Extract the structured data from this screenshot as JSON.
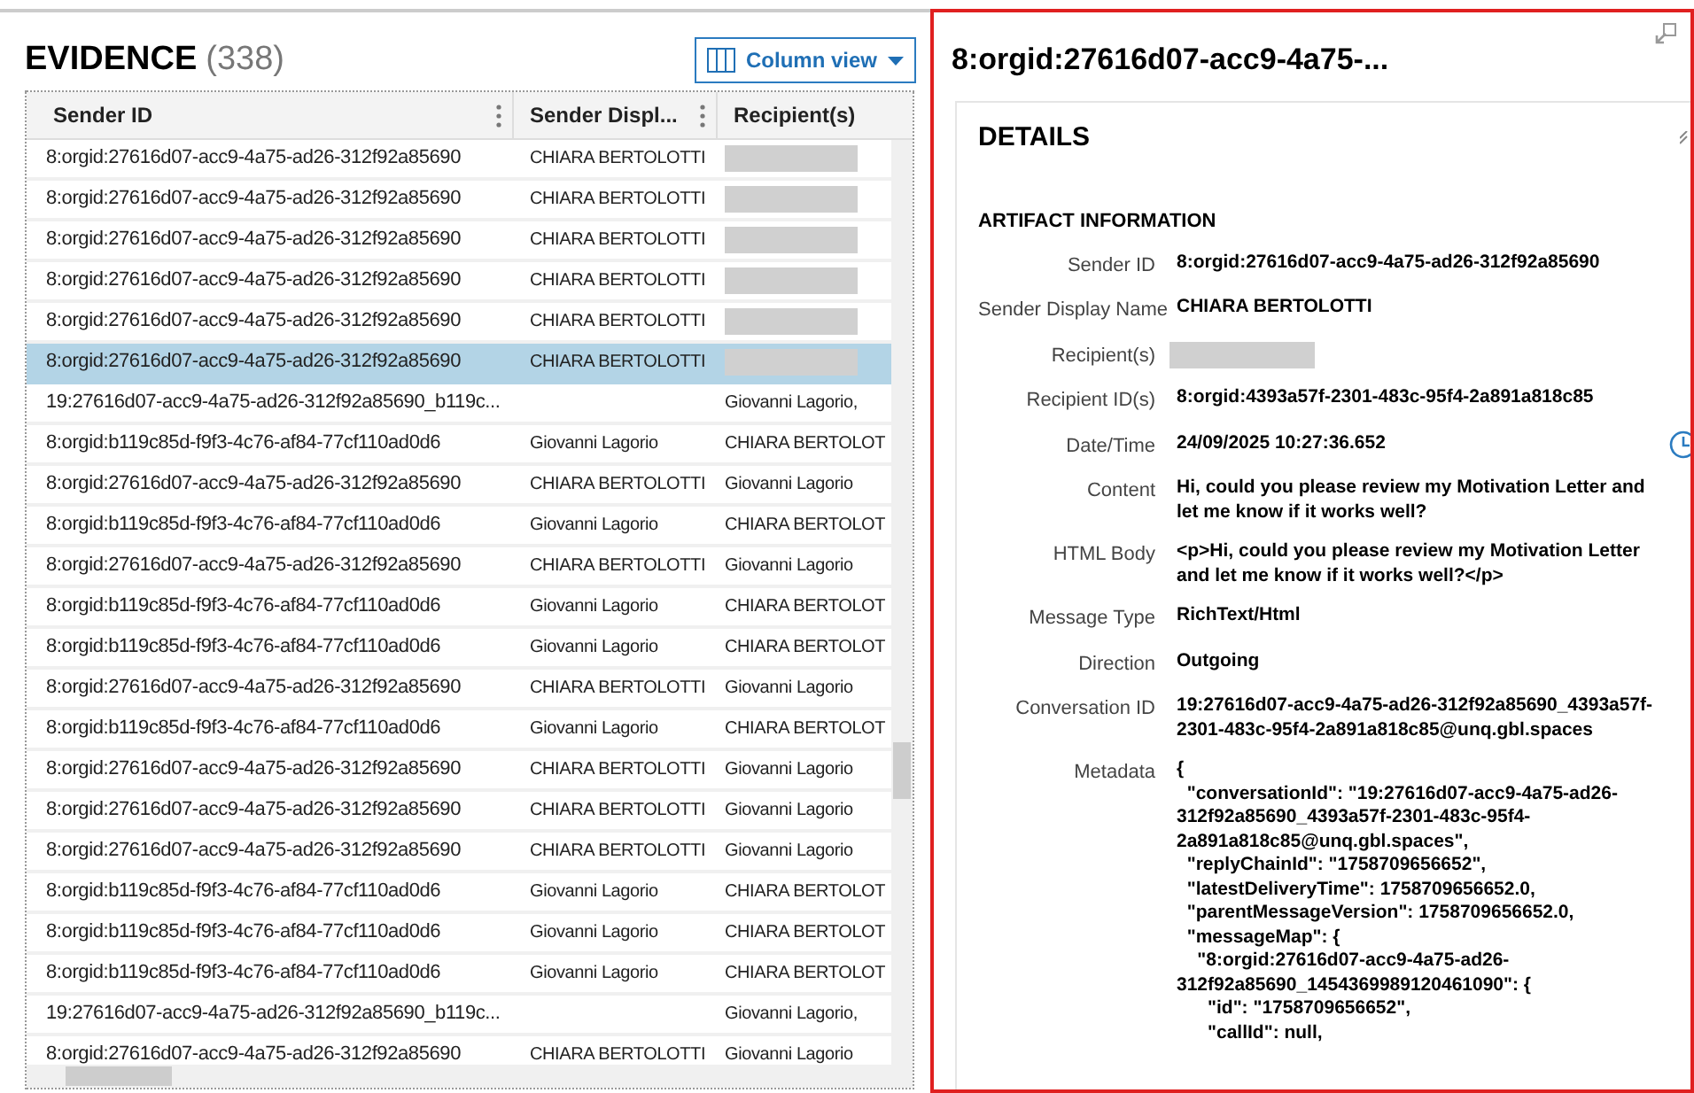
{
  "evidence": {
    "title": "EVIDENCE",
    "count": "(338)",
    "column_view_button": "Column view"
  },
  "table": {
    "columns": [
      "Sender ID",
      "Sender Displ...",
      "Recipient(s)"
    ],
    "rows": [
      {
        "sender_id": "8:orgid:27616d07-acc9-4a75-ad26-312f92a85690",
        "sender_display": "CHIARA BERTOLOTTI",
        "recipient_redacted": true,
        "selected": false
      },
      {
        "sender_id": "8:orgid:27616d07-acc9-4a75-ad26-312f92a85690",
        "sender_display": "CHIARA BERTOLOTTI",
        "recipient_redacted": true,
        "selected": false
      },
      {
        "sender_id": "8:orgid:27616d07-acc9-4a75-ad26-312f92a85690",
        "sender_display": "CHIARA BERTOLOTTI",
        "recipient_redacted": true,
        "selected": false
      },
      {
        "sender_id": "8:orgid:27616d07-acc9-4a75-ad26-312f92a85690",
        "sender_display": "CHIARA BERTOLOTTI",
        "recipient_redacted": true,
        "selected": false
      },
      {
        "sender_id": "8:orgid:27616d07-acc9-4a75-ad26-312f92a85690",
        "sender_display": "CHIARA BERTOLOTTI",
        "recipient_redacted": true,
        "selected": false
      },
      {
        "sender_id": "8:orgid:27616d07-acc9-4a75-ad26-312f92a85690",
        "sender_display": "CHIARA BERTOLOTTI",
        "recipient_redacted": true,
        "selected": true
      },
      {
        "sender_id": "19:27616d07-acc9-4a75-ad26-312f92a85690_b119c...",
        "recipient": "Giovanni Lagorio,",
        "recipient_redacted": false,
        "selected": false
      },
      {
        "sender_id": "8:orgid:b119c85d-f9f3-4c76-af84-77cf110ad0d6",
        "sender_display": "Giovanni Lagorio",
        "recipient": "CHIARA BERTOLOT",
        "recipient_redacted": false,
        "selected": false
      },
      {
        "sender_id": "8:orgid:27616d07-acc9-4a75-ad26-312f92a85690",
        "sender_display": "CHIARA BERTOLOTTI",
        "recipient": "Giovanni Lagorio",
        "recipient_redacted": false,
        "selected": false
      },
      {
        "sender_id": "8:orgid:b119c85d-f9f3-4c76-af84-77cf110ad0d6",
        "sender_display": "Giovanni Lagorio",
        "recipient": "CHIARA BERTOLOT",
        "recipient_redacted": false,
        "selected": false
      },
      {
        "sender_id": "8:orgid:27616d07-acc9-4a75-ad26-312f92a85690",
        "sender_display": "CHIARA BERTOLOTTI",
        "recipient": "Giovanni Lagorio",
        "recipient_redacted": false,
        "selected": false
      },
      {
        "sender_id": "8:orgid:b119c85d-f9f3-4c76-af84-77cf110ad0d6",
        "sender_display": "Giovanni Lagorio",
        "recipient": "CHIARA BERTOLOT",
        "recipient_redacted": false,
        "selected": false
      },
      {
        "sender_id": "8:orgid:b119c85d-f9f3-4c76-af84-77cf110ad0d6",
        "sender_display": "Giovanni Lagorio",
        "recipient": "CHIARA BERTOLOT",
        "recipient_redacted": false,
        "selected": false
      },
      {
        "sender_id": "8:orgid:27616d07-acc9-4a75-ad26-312f92a85690",
        "sender_display": "CHIARA BERTOLOTTI",
        "recipient": "Giovanni Lagorio",
        "recipient_redacted": false,
        "selected": false
      },
      {
        "sender_id": "8:orgid:b119c85d-f9f3-4c76-af84-77cf110ad0d6",
        "sender_display": "Giovanni Lagorio",
        "recipient": "CHIARA BERTOLOT",
        "recipient_redacted": false,
        "selected": false
      },
      {
        "sender_id": "8:orgid:27616d07-acc9-4a75-ad26-312f92a85690",
        "sender_display": "CHIARA BERTOLOTTI",
        "recipient": "Giovanni Lagorio",
        "recipient_redacted": false,
        "selected": false
      },
      {
        "sender_id": "8:orgid:27616d07-acc9-4a75-ad26-312f92a85690",
        "sender_display": "CHIARA BERTOLOTTI",
        "recipient": "Giovanni Lagorio",
        "recipient_redacted": false,
        "selected": false
      },
      {
        "sender_id": "8:orgid:27616d07-acc9-4a75-ad26-312f92a85690",
        "sender_display": "CHIARA BERTOLOTTI",
        "recipient": "Giovanni Lagorio",
        "recipient_redacted": false,
        "selected": false
      },
      {
        "sender_id": "8:orgid:b119c85d-f9f3-4c76-af84-77cf110ad0d6",
        "sender_display": "Giovanni Lagorio",
        "recipient": "CHIARA BERTOLOT",
        "recipient_redacted": false,
        "selected": false
      },
      {
        "sender_id": "8:orgid:b119c85d-f9f3-4c76-af84-77cf110ad0d6",
        "sender_display": "Giovanni Lagorio",
        "recipient": "CHIARA BERTOLOT",
        "recipient_redacted": false,
        "selected": false
      },
      {
        "sender_id": "8:orgid:b119c85d-f9f3-4c76-af84-77cf110ad0d6",
        "sender_display": "Giovanni Lagorio",
        "recipient": "CHIARA BERTOLOT",
        "recipient_redacted": false,
        "selected": false
      },
      {
        "sender_id": "19:27616d07-acc9-4a75-ad26-312f92a85690_b119c...",
        "recipient": "Giovanni Lagorio,",
        "recipient_redacted": false,
        "selected": false
      },
      {
        "sender_id": "8:orgid:27616d07-acc9-4a75-ad26-312f92a85690",
        "sender_display": "CHIARA BERTOLOTTI",
        "recipient": "Giovanni Lagorio",
        "recipient_redacted": false,
        "selected": false
      }
    ]
  },
  "detail": {
    "title": "8:orgid:27616d07-acc9-4a75-...",
    "card_title": "DETAILS",
    "section_title": "ARTIFACT INFORMATION",
    "fields": [
      {
        "label": "Sender ID",
        "value": "8:orgid:27616d07-acc9-4a75-ad26-312f92a85690",
        "kind": "text"
      },
      {
        "label": "Sender Display Name",
        "value": "CHIARA BERTOLOTTI",
        "kind": "text"
      },
      {
        "label": "Recipient(s)",
        "kind": "redacted"
      },
      {
        "label": "Recipient ID(s)",
        "value": "8:orgid:4393a57f-2301-483c-95f4-2a891a818c85",
        "kind": "text"
      },
      {
        "label": "Date/Time",
        "value": "24/09/2025 10:27:36.652",
        "kind": "time"
      },
      {
        "label": "Content",
        "value": "Hi, could you please review my Motivation Letter and let me know if it works well?",
        "kind": "text"
      },
      {
        "label": "HTML Body",
        "value": "<p>Hi, could you please review my Motivation Letter and let me know if it works well?</p>",
        "kind": "text"
      },
      {
        "label": "Message Type",
        "value": "RichText/Html",
        "kind": "text"
      },
      {
        "label": "Direction",
        "value": "Outgoing",
        "kind": "text"
      },
      {
        "label": "Conversation ID",
        "value": "19:27616d07-acc9-4a75-ad26-312f92a85690_4393a57f-2301-483c-95f4-2a891a818c85@unq.gbl.spaces",
        "kind": "text"
      },
      {
        "label": "Metadata",
        "kind": "code",
        "lines": [
          "{",
          "  \"conversationId\": \"19:27616d07-acc9-4a75-ad26-312f92a85690_4393a57f-2301-483c-95f4-2a891a818c85@unq.gbl.spaces\",",
          "  \"replyChainId\": \"1758709656652\",",
          "  \"latestDeliveryTime\": 1758709656652.0,",
          "  \"parentMessageVersion\": 1758709656652.0,",
          "  \"messageMap\": {",
          "    \"8:orgid:27616d07-acc9-4a75-ad26-312f92a85690_1454369989120461090\": {",
          "      \"id\": \"1758709656652\",",
          "      \"callId\": null,"
        ]
      }
    ]
  }
}
